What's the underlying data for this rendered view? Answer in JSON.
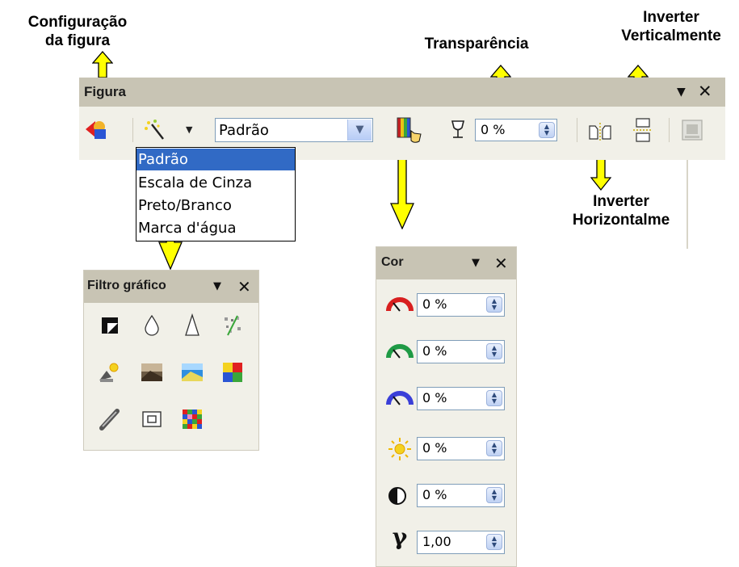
{
  "callouts": {
    "configuracao": [
      "Configuração",
      "da figura"
    ],
    "transparencia": "Transparência",
    "inverter_vertical": [
      "Inverter",
      "Verticalmente"
    ],
    "inverter_horizontal": [
      "Inverter",
      "Horizontalme"
    ]
  },
  "colors": {
    "callout_arrow": "#ffff00",
    "toolbar_bg": "#f1f0e8",
    "titlebar_bg": "#c8c4b4",
    "selection": "#316ac5"
  },
  "toolbar": {
    "title": "Figura",
    "menu_glyph": "▼",
    "close_glyph": "✕",
    "icons": [
      "figure-config-icon",
      "graphic-filter-icon",
      "color-icon",
      "transparency-icon",
      "flip-horizontal-icon",
      "flip-vertical-icon",
      "figure-properties-icon"
    ],
    "mode_select": {
      "value": "Padrão",
      "options": [
        "Padrão",
        "Escala de Cinza",
        "Preto/Branco",
        "Marca d'água"
      ],
      "selected_index": 0
    },
    "transparency_value": "0 %"
  },
  "filtro": {
    "title": "Filtro gráfico",
    "menu_glyph": "▼",
    "close_glyph": "✕",
    "filters": [
      "invert-icon",
      "smooth-icon",
      "sharpen-icon",
      "remove-noise-icon",
      "solarization-icon",
      "aging-icon",
      "posterize-icon",
      "pop-art-icon",
      "charcoal-sketch-icon",
      "relief-icon",
      "mosaic-icon"
    ]
  },
  "cor": {
    "title": "Cor",
    "menu_glyph": "▼",
    "close_glyph": "✕",
    "rows": [
      {
        "icon": "red-gauge-icon",
        "value": "0 %"
      },
      {
        "icon": "green-gauge-icon",
        "value": "0 %"
      },
      {
        "icon": "blue-gauge-icon",
        "value": "0 %"
      },
      {
        "icon": "brightness-icon",
        "value": "0 %"
      },
      {
        "icon": "contrast-icon",
        "value": "0 %"
      },
      {
        "icon": "gamma-icon",
        "value": "1,00"
      }
    ]
  }
}
